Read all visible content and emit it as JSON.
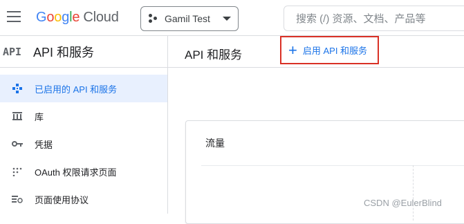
{
  "header": {
    "logo_text": "Google Cloud",
    "project_name": "Gamil Test",
    "search_placeholder": "搜索 (/) 资源、文档、产品等"
  },
  "sidebar": {
    "logo_text": "API",
    "title": "API 和服务",
    "items": [
      {
        "label": "已启用的 API 和服务",
        "icon": "api-diamond-icon",
        "active": true
      },
      {
        "label": "库",
        "icon": "library-icon",
        "active": false
      },
      {
        "label": "凭据",
        "icon": "key-icon",
        "active": false
      },
      {
        "label": "OAuth 权限请求页面",
        "icon": "oauth-dots-icon",
        "active": false
      },
      {
        "label": "页面使用协议",
        "icon": "settings-list-icon",
        "active": false
      }
    ]
  },
  "main": {
    "title": "API 和服务",
    "enable_button_label": "启用 API 和服务",
    "card_title": "流量"
  },
  "watermark": "CSDN @EulerBlind",
  "colors": {
    "accent": "#1a73e8",
    "active_bg": "#e8f0fe",
    "highlight_border": "#d93025"
  }
}
